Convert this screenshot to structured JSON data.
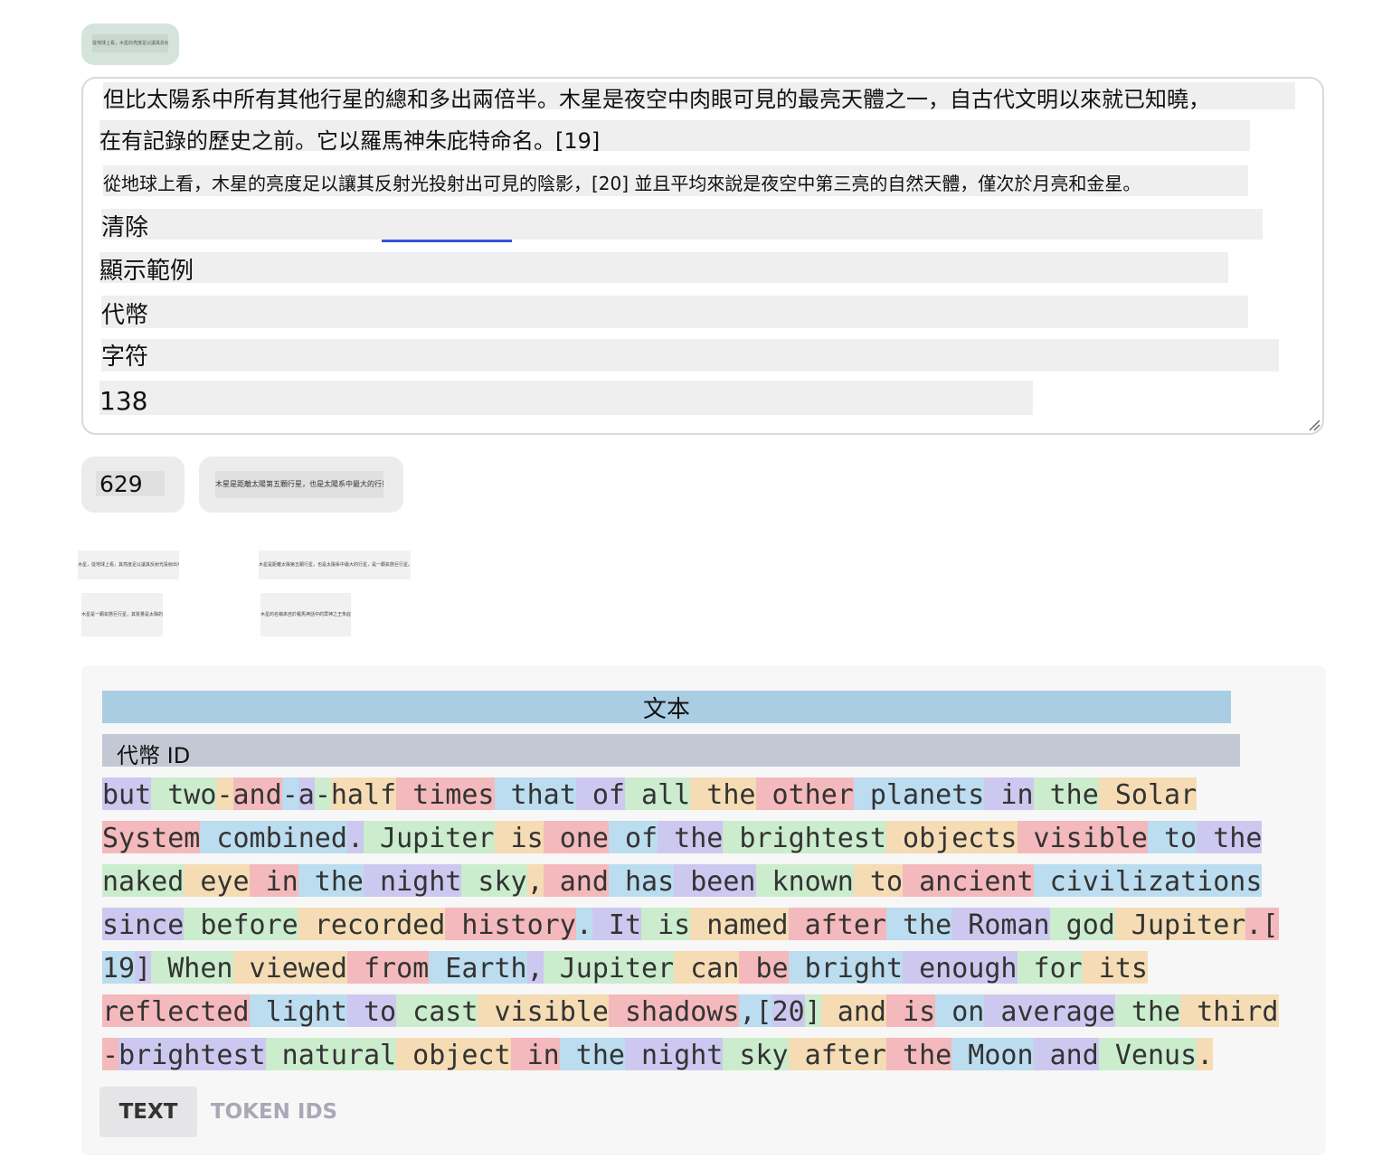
{
  "top_button": {
    "label": "從地球上看，木星的亮度足以讓其反射光投射出可見的陰影"
  },
  "textarea": {
    "lines": [
      "但比太陽系中所有其他行星的總和多出兩倍半。木星是夜空中肉眼可見的最亮天體之一，自古代文明以來就已知曉，",
      "在有記錄的歷史之前。它以羅馬神朱庇特命名。[19]",
      "從地球上看，木星的亮度足以讓其反射光投射出可見的陰影，[20] 並且平均來說是夜空中第三亮的自然天體，僅次於月亮和金星。",
      "清除",
      "顯示範例",
      "代幣",
      "字符",
      "138"
    ]
  },
  "controls": {
    "count_button": "629",
    "wide_button": "木星是距離太陽第五顆行星，也是太陽系中最大的行星。"
  },
  "small_labels": [
    "木星，從地球上看，其亮度足以讓其反射光投射出可見的陰影。",
    "木星是距離太陽第五顆行星，也是太陽系中最大的行星，是一顆氣態巨行星。",
    "木星是一顆氣態巨行星，其質量是太陽的千分之一。",
    "木星的名稱來自於羅馬神話中的眾神之王朱庇特。"
  ],
  "output": {
    "header_text": "文本",
    "header_ids": "代幣 ID",
    "token_lines": [
      [
        [
          "but",
          "p"
        ],
        [
          " two",
          "g"
        ],
        [
          "-",
          "o"
        ],
        [
          "and",
          "r"
        ],
        [
          "-",
          "b"
        ],
        [
          "a",
          "p"
        ],
        [
          "-",
          "g"
        ],
        [
          "half",
          "o"
        ],
        [
          " times",
          "r"
        ],
        [
          " that",
          "b"
        ],
        [
          " of",
          "p"
        ],
        [
          " all",
          "g"
        ],
        [
          " the",
          "o"
        ],
        [
          " other",
          "r"
        ],
        [
          " planets",
          "b"
        ],
        [
          " in",
          "p"
        ],
        [
          " the",
          "g"
        ],
        [
          " Solar",
          "o"
        ]
      ],
      [
        [
          "System",
          "r"
        ],
        [
          " combined",
          "b"
        ],
        [
          ".",
          "p"
        ],
        [
          " Jupiter",
          "g"
        ],
        [
          " is",
          "o"
        ],
        [
          " one",
          "r"
        ],
        [
          " of",
          "b"
        ],
        [
          " the",
          "p"
        ],
        [
          " brightest",
          "g"
        ],
        [
          " objects",
          "o"
        ],
        [
          " visible",
          "r"
        ],
        [
          " to",
          "b"
        ],
        [
          " the",
          "p"
        ]
      ],
      [
        [
          "naked",
          "g"
        ],
        [
          " eye",
          "o"
        ],
        [
          " in",
          "r"
        ],
        [
          " the",
          "b"
        ],
        [
          " night",
          "p"
        ],
        [
          " sky",
          "g"
        ],
        [
          ",",
          "o"
        ],
        [
          " and",
          "r"
        ],
        [
          " has",
          "b"
        ],
        [
          " been",
          "p"
        ],
        [
          " known",
          "g"
        ],
        [
          " to",
          "o"
        ],
        [
          " ancient",
          "r"
        ],
        [
          " civilizations",
          "b"
        ]
      ],
      [
        [
          "since",
          "p"
        ],
        [
          " before",
          "g"
        ],
        [
          " recorded",
          "o"
        ],
        [
          " history",
          "r"
        ],
        [
          ".",
          "b"
        ],
        [
          " It",
          "p"
        ],
        [
          " is",
          "g"
        ],
        [
          " named",
          "o"
        ],
        [
          " after",
          "r"
        ],
        [
          " the",
          "b"
        ],
        [
          " Roman",
          "p"
        ],
        [
          " god",
          "g"
        ],
        [
          " Jupiter",
          "o"
        ],
        [
          ".[",
          "r"
        ]
      ],
      [
        [
          "19",
          "b"
        ],
        [
          "]",
          "p"
        ],
        [
          " When",
          "g"
        ],
        [
          " viewed",
          "o"
        ],
        [
          " from",
          "r"
        ],
        [
          " Earth",
          "b"
        ],
        [
          ",",
          "p"
        ],
        [
          " Jupiter",
          "g"
        ],
        [
          " can",
          "o"
        ],
        [
          " be",
          "r"
        ],
        [
          " bright",
          "b"
        ],
        [
          " enough",
          "p"
        ],
        [
          " for",
          "g"
        ],
        [
          " its",
          "o"
        ]
      ],
      [
        [
          "reflected",
          "r"
        ],
        [
          " light",
          "b"
        ],
        [
          " to",
          "p"
        ],
        [
          " cast",
          "g"
        ],
        [
          " visible",
          "o"
        ],
        [
          " shadows",
          "r"
        ],
        [
          ",[",
          "b"
        ],
        [
          "20",
          "p"
        ],
        [
          "]",
          "g"
        ],
        [
          " and",
          "o"
        ],
        [
          " is",
          "r"
        ],
        [
          " on",
          "b"
        ],
        [
          " average",
          "p"
        ],
        [
          " the",
          "g"
        ],
        [
          " third",
          "o"
        ]
      ],
      [
        [
          "-",
          "r"
        ],
        [
          "brightest",
          "p"
        ],
        [
          " natural",
          "g"
        ],
        [
          " object",
          "o"
        ],
        [
          " in",
          "r"
        ],
        [
          " the",
          "b"
        ],
        [
          " night",
          "p"
        ],
        [
          " sky",
          "g"
        ],
        [
          " after",
          "o"
        ],
        [
          " the",
          "r"
        ],
        [
          " Moon",
          "b"
        ],
        [
          " and",
          "p"
        ],
        [
          " Venus",
          "g"
        ],
        [
          ".",
          "o"
        ]
      ]
    ],
    "token_colors": {
      "p": "#cdc8ef",
      "g": "#cbeccd",
      "o": "#f5dcb4",
      "r": "#f3b9bc",
      "b": "#bcdcef"
    }
  },
  "tabs": {
    "text_label": "TEXT",
    "ids_label": "TOKEN IDS"
  }
}
